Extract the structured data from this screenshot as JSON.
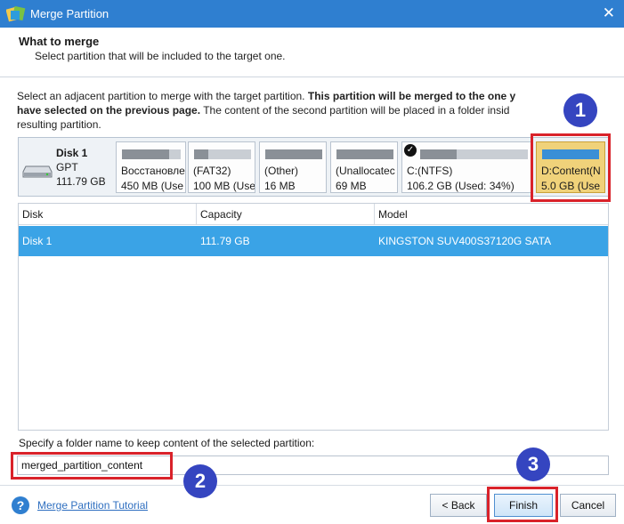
{
  "window": {
    "title": "Merge Partition",
    "close_glyph": "✕"
  },
  "header": {
    "title": "What to merge",
    "subtitle": "Select partition that will be included to the target one."
  },
  "instructions": {
    "line1_plain": "Select an adjacent partition to merge with the target partition. ",
    "line1_bold": "This partition will be merged to the one y",
    "line2_bold": "have selected on the previous page.",
    "line2_plain": " The content of the second partition will be placed in a folder insid",
    "line3_plain": "resulting partition."
  },
  "disk": {
    "name": "Disk 1",
    "type": "GPT",
    "size": "111.79 GB"
  },
  "partitions": [
    {
      "name": "Восстановле",
      "info": "450 MB (Use",
      "usage": 0.8
    },
    {
      "name": "(FAT32)",
      "info": "100 MB (Use",
      "usage": 0.25
    },
    {
      "name": "(Other)",
      "info": "16 MB",
      "usage": 1.0
    },
    {
      "name": "(Unallocatec",
      "info": "69 MB",
      "usage": 1.0
    },
    {
      "name": "C:(NTFS)",
      "info": "106.2 GB (Used: 34%)",
      "usage": 0.34,
      "checked": true,
      "check_glyph": "✓"
    },
    {
      "name": "D:Content(N",
      "info": "5.0 GB (Use",
      "usage": 0,
      "selected": true
    }
  ],
  "table": {
    "columns": [
      "Disk",
      "Capacity",
      "Model"
    ],
    "rows": [
      {
        "disk": "Disk 1",
        "capacity": "111.79 GB",
        "model": "KINGSTON SUV400S37120G SATA"
      }
    ]
  },
  "folder": {
    "label": "Specify a folder name to keep content of the selected partition:",
    "value": "merged_partition_content"
  },
  "footer": {
    "help_glyph": "?",
    "tutorial_link": "Merge Partition Tutorial",
    "back_label": "< Back",
    "finish_label": "Finish",
    "cancel_label": "Cancel"
  },
  "annotations": {
    "badge1": "1",
    "badge2": "2",
    "badge3": "3",
    "highlight_color": "#d9222a",
    "badge_color": "#3545c0"
  },
  "colors": {
    "titlebar": "#2f7fd0",
    "row_selected": "#3aa3e6",
    "partition_selected": "#f0d27a"
  }
}
